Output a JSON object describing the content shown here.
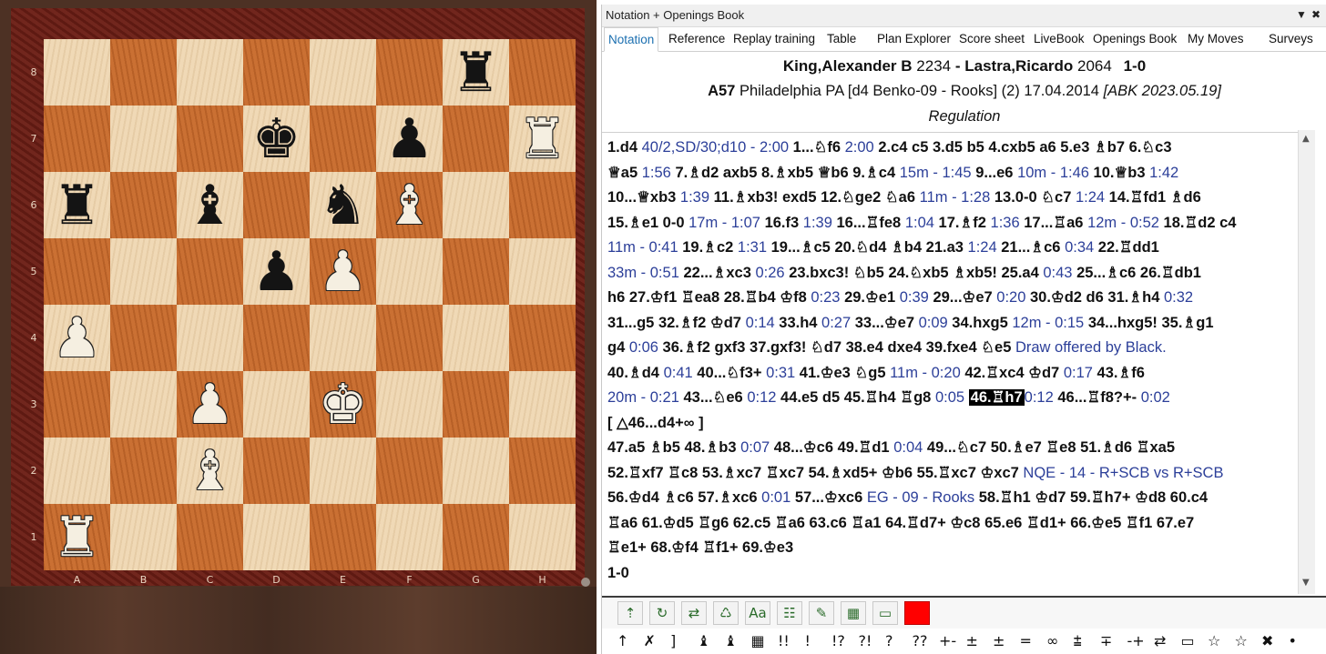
{
  "board": {
    "files": [
      "A",
      "B",
      "C",
      "D",
      "E",
      "F",
      "G",
      "H"
    ],
    "ranks": [
      "8",
      "7",
      "6",
      "5",
      "4",
      "3",
      "2",
      "1"
    ],
    "position": [
      [
        "",
        "",
        "",
        "",
        "",
        "",
        "r",
        ""
      ],
      [
        "",
        "",
        "",
        "k",
        "",
        "p",
        "",
        "R"
      ],
      [
        "r",
        "",
        "b",
        "",
        "n",
        "B",
        "",
        ""
      ],
      [
        "",
        "",
        "",
        "p",
        "P",
        "",
        "",
        ""
      ],
      [
        "P",
        "",
        "",
        "",
        "",
        "",
        "",
        ""
      ],
      [
        "",
        "",
        "P",
        "",
        "K",
        "",
        "",
        ""
      ],
      [
        "",
        "",
        "B",
        "",
        "",
        "",
        "",
        ""
      ],
      [
        "R",
        "",
        "",
        "",
        "",
        "",
        "",
        ""
      ]
    ],
    "glyphs": {
      "k": "♚",
      "q": "♛",
      "r": "♜",
      "b": "♝",
      "n": "♞",
      "p": "♟",
      "K": "♚",
      "Q": "♛",
      "R": "♜",
      "B": "♝",
      "N": "♞",
      "P": "♟"
    }
  },
  "panel": {
    "title": "Notation + Openings Book",
    "menu_icon": "▼",
    "close_icon": "✖",
    "tabs": [
      {
        "label": "Notation",
        "active": true
      },
      {
        "label": "Reference"
      },
      {
        "label": "Replay training"
      },
      {
        "label": "Table"
      },
      {
        "label": "Plan Explorer"
      },
      {
        "label": "Score sheet"
      },
      {
        "label": "LiveBook"
      },
      {
        "label": "Openings Book"
      },
      {
        "label": "My Moves"
      },
      {
        "label": "Surveys"
      }
    ]
  },
  "game": {
    "white": "King,Alexander B",
    "white_elo": "2234",
    "black": "Lastra,Ricardo",
    "black_elo": "2064",
    "result": "1-0",
    "eco": "A57",
    "event": "Philadelphia PA [d4 Benko-09 - Rooks] (2) 17.04.2014",
    "annotator": "[ABK 2023.05.19]",
    "round_name": "Regulation"
  },
  "notation": {
    "lines": [
      [
        [
          "m",
          "1.d4 "
        ],
        [
          "c",
          "40/2,SD/30;d10 - 2:00 "
        ],
        [
          "m",
          " 1...♘f6 "
        ],
        [
          "c",
          "2:00 "
        ],
        [
          "m",
          " 2.c4  c5  3.d5  b5  4.cxb5  a6  5.e3  ♗b7  6.♘c3"
        ]
      ],
      [
        [
          "m",
          "♕a5 "
        ],
        [
          "c",
          "1:56 "
        ],
        [
          "m",
          " 7.♗d2  axb5  8.♗xb5  ♕b6  9.♗c4 "
        ],
        [
          "c",
          "15m - 1:45 "
        ],
        [
          "m",
          " 9...e6 "
        ],
        [
          "c",
          "10m - 1:46 "
        ],
        [
          "m",
          " 10.♕b3 "
        ],
        [
          "c",
          "1:42"
        ]
      ],
      [
        [
          "m",
          "10...♕xb3 "
        ],
        [
          "c",
          "1:39 "
        ],
        [
          "m",
          " 11.♗xb3!  exd5  12.♘ge2  ♘a6 "
        ],
        [
          "c",
          "11m - 1:28 "
        ],
        [
          "m",
          " 13.0-0  ♘c7 "
        ],
        [
          "c",
          "1:24 "
        ],
        [
          "m",
          " 14.♖fd1  ♗d6"
        ]
      ],
      [
        [
          "m",
          "15.♗e1  0-0 "
        ],
        [
          "c",
          "17m - 1:07 "
        ],
        [
          "m",
          " 16.f3 "
        ],
        [
          "c",
          "1:39 "
        ],
        [
          "m",
          " 16...♖fe8 "
        ],
        [
          "c",
          "1:04 "
        ],
        [
          "m",
          " 17.♗f2 "
        ],
        [
          "c",
          "1:36 "
        ],
        [
          "m",
          " 17...♖a6 "
        ],
        [
          "c",
          "12m - 0:52 "
        ],
        [
          "m",
          " 18.♖d2  c4"
        ]
      ],
      [
        [
          "c",
          "11m - 0:41 "
        ],
        [
          "m",
          " 19.♗c2 "
        ],
        [
          "c",
          "1:31 "
        ],
        [
          "m",
          " 19...♗c5  20.♘d4  ♗b4  21.a3 "
        ],
        [
          "c",
          "1:24 "
        ],
        [
          "m",
          " 21...♗c6 "
        ],
        [
          "c",
          "0:34 "
        ],
        [
          "m",
          " 22.♖dd1"
        ]
      ],
      [
        [
          "c",
          "33m - 0:51 "
        ],
        [
          "m",
          " 22...♗xc3 "
        ],
        [
          "c",
          "0:26 "
        ],
        [
          "m",
          " 23.bxc3!  ♘b5  24.♘xb5  ♗xb5!  25.a4 "
        ],
        [
          "c",
          "0:43 "
        ],
        [
          "m",
          " 25...♗c6  26.♖db1"
        ]
      ],
      [
        [
          "m",
          "h6  27.♔f1  ♖ea8  28.♖b4  ♔f8 "
        ],
        [
          "c",
          "0:23 "
        ],
        [
          "m",
          " 29.♔e1 "
        ],
        [
          "c",
          "0:39 "
        ],
        [
          "m",
          " 29...♔e7 "
        ],
        [
          "c",
          "0:20 "
        ],
        [
          "m",
          " 30.♔d2  d6  31.♗h4 "
        ],
        [
          "c",
          "0:32"
        ]
      ],
      [
        [
          "m",
          "31...g5  32.♗f2  ♔d7 "
        ],
        [
          "c",
          "0:14 "
        ],
        [
          "m",
          " 33.h4 "
        ],
        [
          "c",
          "0:27 "
        ],
        [
          "m",
          " 33...♔e7 "
        ],
        [
          "c",
          "0:09 "
        ],
        [
          "m",
          " 34.hxg5 "
        ],
        [
          "c",
          "12m - 0:15 "
        ],
        [
          "m",
          " 34...hxg5!  35.♗g1"
        ]
      ],
      [
        [
          "m",
          "g4 "
        ],
        [
          "c",
          "0:06 "
        ],
        [
          "m",
          " 36.♗f2  gxf3  37.gxf3!  ♘d7  38.e4  dxe4  39.fxe4  ♘e5 "
        ],
        [
          "c",
          "Draw offered by Black."
        ]
      ],
      [
        [
          "m",
          "40.♗d4 "
        ],
        [
          "c",
          "0:41 "
        ],
        [
          "m",
          " 40...♘f3+ "
        ],
        [
          "c",
          "0:31 "
        ],
        [
          "m",
          " 41.♔e3  ♘g5 "
        ],
        [
          "c",
          "11m - 0:20 "
        ],
        [
          "m",
          " 42.♖xc4  ♔d7 "
        ],
        [
          "c",
          "0:17 "
        ],
        [
          "m",
          " 43.♗f6"
        ]
      ],
      [
        [
          "c",
          "20m - 0:21 "
        ],
        [
          "m",
          " 43...♘e6 "
        ],
        [
          "c",
          "0:12 "
        ],
        [
          "m",
          " 44.e5  d5  45.♖h4  ♖g8 "
        ],
        [
          "c",
          "0:05 "
        ],
        [
          "x",
          "46.♖h7"
        ],
        [
          "c",
          "0:12 "
        ],
        [
          "m",
          " 46...♖f8?+- "
        ],
        [
          "c",
          "0:02"
        ]
      ],
      [
        [
          "m",
          "      [ △46...d4+∞ ]"
        ]
      ],
      [
        [
          "m",
          "47.a5  ♗b5  48.♗b3 "
        ],
        [
          "c",
          "0:07 "
        ],
        [
          "m",
          " 48...♔c6  49.♖d1 "
        ],
        [
          "c",
          "0:04 "
        ],
        [
          "m",
          " 49...♘c7  50.♗e7  ♖e8  51.♗d6  ♖xa5"
        ]
      ],
      [
        [
          "m",
          "52.♖xf7  ♖c8  53.♗xc7  ♖xc7  54.♗xd5+  ♔b6  55.♖xc7  ♔xc7 "
        ],
        [
          "c",
          "NQE - 14 - R+SCB vs R+SCB"
        ]
      ],
      [
        [
          "m",
          "56.♔d4  ♗c6  57.♗xc6 "
        ],
        [
          "c",
          "0:01 "
        ],
        [
          "m",
          " 57...♔xc6 "
        ],
        [
          "c",
          "EG - 09 - Rooks "
        ],
        [
          "m",
          " 58.♖h1  ♔d7  59.♖h7+  ♔d8  60.c4"
        ]
      ],
      [
        [
          "m",
          "♖a6  61.♔d5  ♖g6  62.c5  ♖a6  63.c6  ♖a1  64.♖d7+  ♔c8  65.e6  ♖d1+  66.♔e5  ♖f1  67.e7"
        ]
      ],
      [
        [
          "m",
          "♖e1+  68.♔f4  ♖f1+  69.♔e3"
        ]
      ],
      [
        [
          "m",
          "1-0"
        ]
      ]
    ]
  },
  "toolbar": {
    "buttons": [
      {
        "name": "move-up-icon",
        "glyph": "⇡"
      },
      {
        "name": "swirl-icon",
        "glyph": "↻"
      },
      {
        "name": "arrows-icon",
        "glyph": "⇄"
      },
      {
        "name": "recycle-icon",
        "glyph": "♺"
      },
      {
        "name": "font-icon",
        "glyph": "Aa"
      },
      {
        "name": "tree-icon",
        "glyph": "☷"
      },
      {
        "name": "pen-icon",
        "glyph": "✎"
      },
      {
        "name": "board-icon",
        "glyph": "▦"
      },
      {
        "name": "eraser-icon",
        "glyph": "▭"
      },
      {
        "name": "red-color-icon",
        "glyph": ""
      }
    ],
    "symbols": [
      "↑",
      "✗",
      "]",
      "♝",
      "♝",
      "▦",
      "!!",
      "!",
      "!?",
      "?!",
      "?",
      "??",
      "+-",
      "±",
      "±",
      "=",
      "∞",
      "⩲",
      "∓",
      "-+",
      "⇄",
      "▭",
      "☆",
      "☆",
      "✖",
      "•"
    ]
  }
}
